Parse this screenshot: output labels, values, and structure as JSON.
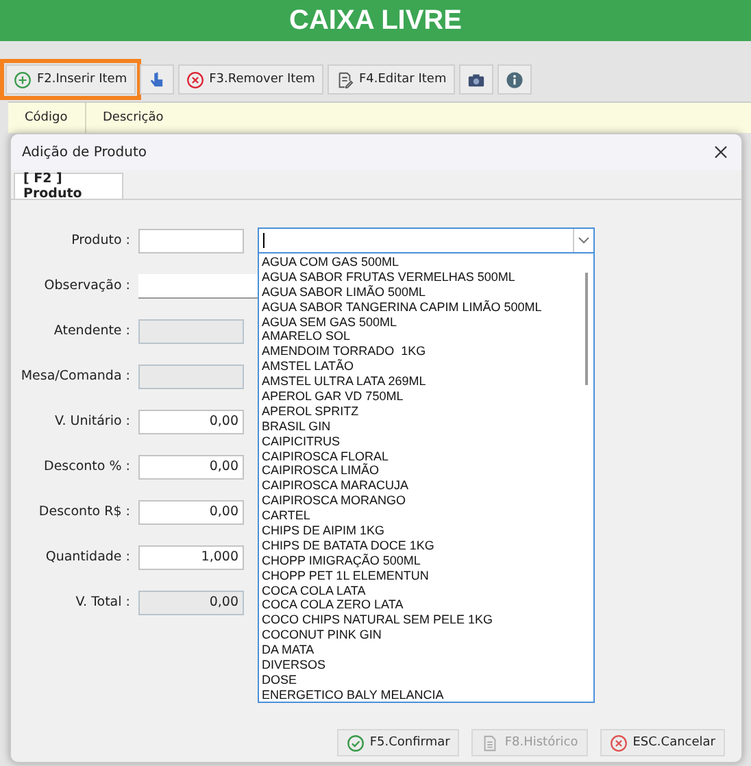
{
  "header": {
    "title": "CAIXA LIVRE"
  },
  "toolbar": [
    {
      "kind": "add",
      "label": "F2.Inserir Item",
      "highlighted": true
    },
    {
      "kind": "hand",
      "highlighted": false
    },
    {
      "kind": "remove",
      "label": "F3.Remover Item",
      "highlighted": false
    },
    {
      "kind": "edit",
      "label": "F4.Editar Item",
      "highlighted": false
    },
    {
      "kind": "camera",
      "highlighted": false
    },
    {
      "kind": "info",
      "highlighted": false
    }
  ],
  "table": {
    "columns": [
      "Código",
      "Descrição"
    ]
  },
  "dialog": {
    "title": "Adição de Produto",
    "tabs": [
      {
        "label": "[ F2 ] Produto",
        "selected": true
      }
    ],
    "fields": [
      {
        "label": "Produto :",
        "kind": "product"
      },
      {
        "label": "Observação :",
        "kind": "wide"
      },
      {
        "label": "Atendente :",
        "kind": "readonly"
      },
      {
        "label": "Mesa/Comanda :",
        "kind": "readonly"
      },
      {
        "label": "V. Unitário :",
        "kind": "text",
        "value": "0,00"
      },
      {
        "label": "Desconto % :",
        "kind": "text",
        "value": "0,00"
      },
      {
        "label": "Desconto R$ :",
        "kind": "text",
        "value": "0,00"
      },
      {
        "label": "Quantidade :",
        "kind": "text",
        "value": "1,000"
      },
      {
        "label": "V. Total :",
        "kind": "readonly",
        "value": "0,00"
      }
    ],
    "product_dropdown": {
      "expanded": true,
      "items": [
        "AGUA COM GAS 500ML",
        "AGUA SABOR FRUTAS VERMELHAS 500ML",
        "AGUA SABOR LIMÃO 500ML",
        "AGUA SABOR TANGERINA CAPIM LIMÃO 500ML",
        "AGUA SEM GAS 500ML",
        "AMARELO SOL",
        "AMENDOIM TORRADO  1KG",
        "AMSTEL LATÃO",
        "AMSTEL ULTRA LATA 269ML",
        "APEROL GAR VD 750ML",
        "APEROL SPRITZ",
        "BRASIL GIN",
        "CAIPICITRUS",
        "CAIPIROSCA FLORAL",
        "CAIPIROSCA LIMÃO",
        "CAIPIROSCA MARACUJA",
        "CAIPIROSCA MORANGO",
        "CARTEL",
        "CHIPS DE AIPIM 1KG",
        "CHIPS DE BATATA DOCE 1KG",
        "CHOPP IMIGRAÇÃO 500ML",
        "CHOPP PET 1L ELEMENTUN",
        "COCA COLA LATA",
        "COCA COLA ZERO LATA",
        "COCO CHIPS NATURAL SEM PELE 1KG",
        "COCONUT PINK GIN",
        "DA MATA",
        "DIVERSOS",
        "DOSE",
        "ENERGETICO BALY MELANCIA"
      ]
    },
    "buttons": [
      {
        "kind": "confirm",
        "label": "F5.Confirmar",
        "disabled": false
      },
      {
        "kind": "history",
        "label": "F8.Histórico",
        "disabled": true
      },
      {
        "kind": "cancel",
        "label": "ESC.Cancelar",
        "disabled": false
      }
    ]
  }
}
